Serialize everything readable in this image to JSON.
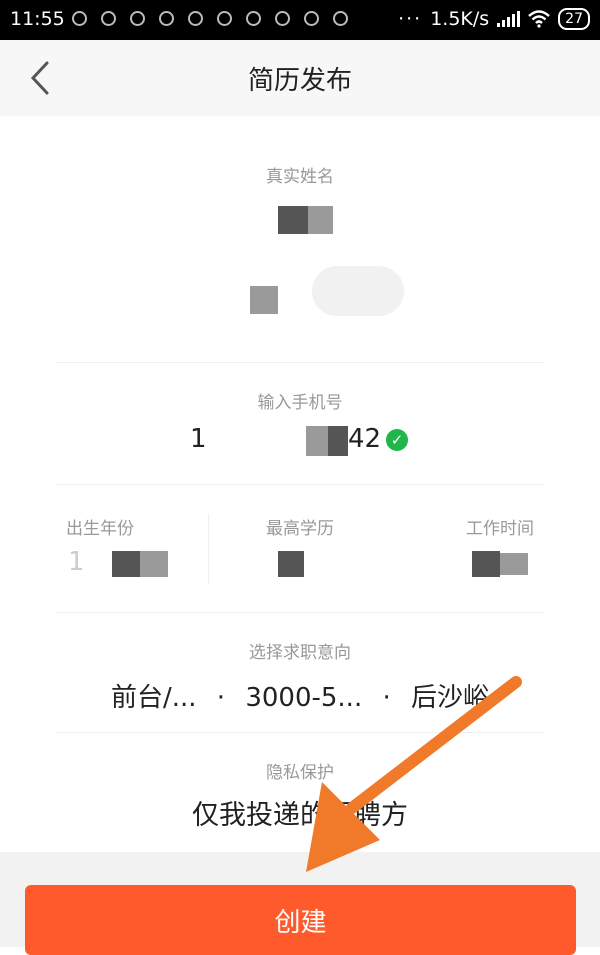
{
  "status_bar": {
    "time": "11:55",
    "more": "···",
    "network_speed": "1.5K/s",
    "battery": "27"
  },
  "header": {
    "title": "简历发布"
  },
  "form": {
    "name": {
      "label": "真实姓名"
    },
    "phone": {
      "label": "输入手机号",
      "prefix": "1",
      "suffix": "42"
    },
    "birth_year": {
      "label": "出生年份",
      "prefix": "1"
    },
    "education": {
      "label": "最高学历"
    },
    "work_time": {
      "label": "工作时间"
    },
    "job_intent": {
      "label": "选择求职意向",
      "position": "前台/...",
      "sep": "·",
      "salary": "3000-5...",
      "location": "后沙峪"
    },
    "privacy": {
      "label": "隐私保护",
      "value": "仅我投递的招聘方"
    }
  },
  "actions": {
    "create_label": "创建"
  },
  "colors": {
    "accent": "#ff5a2b",
    "annotation_arrow": "#f07a2a",
    "verified": "#1fb74b"
  }
}
